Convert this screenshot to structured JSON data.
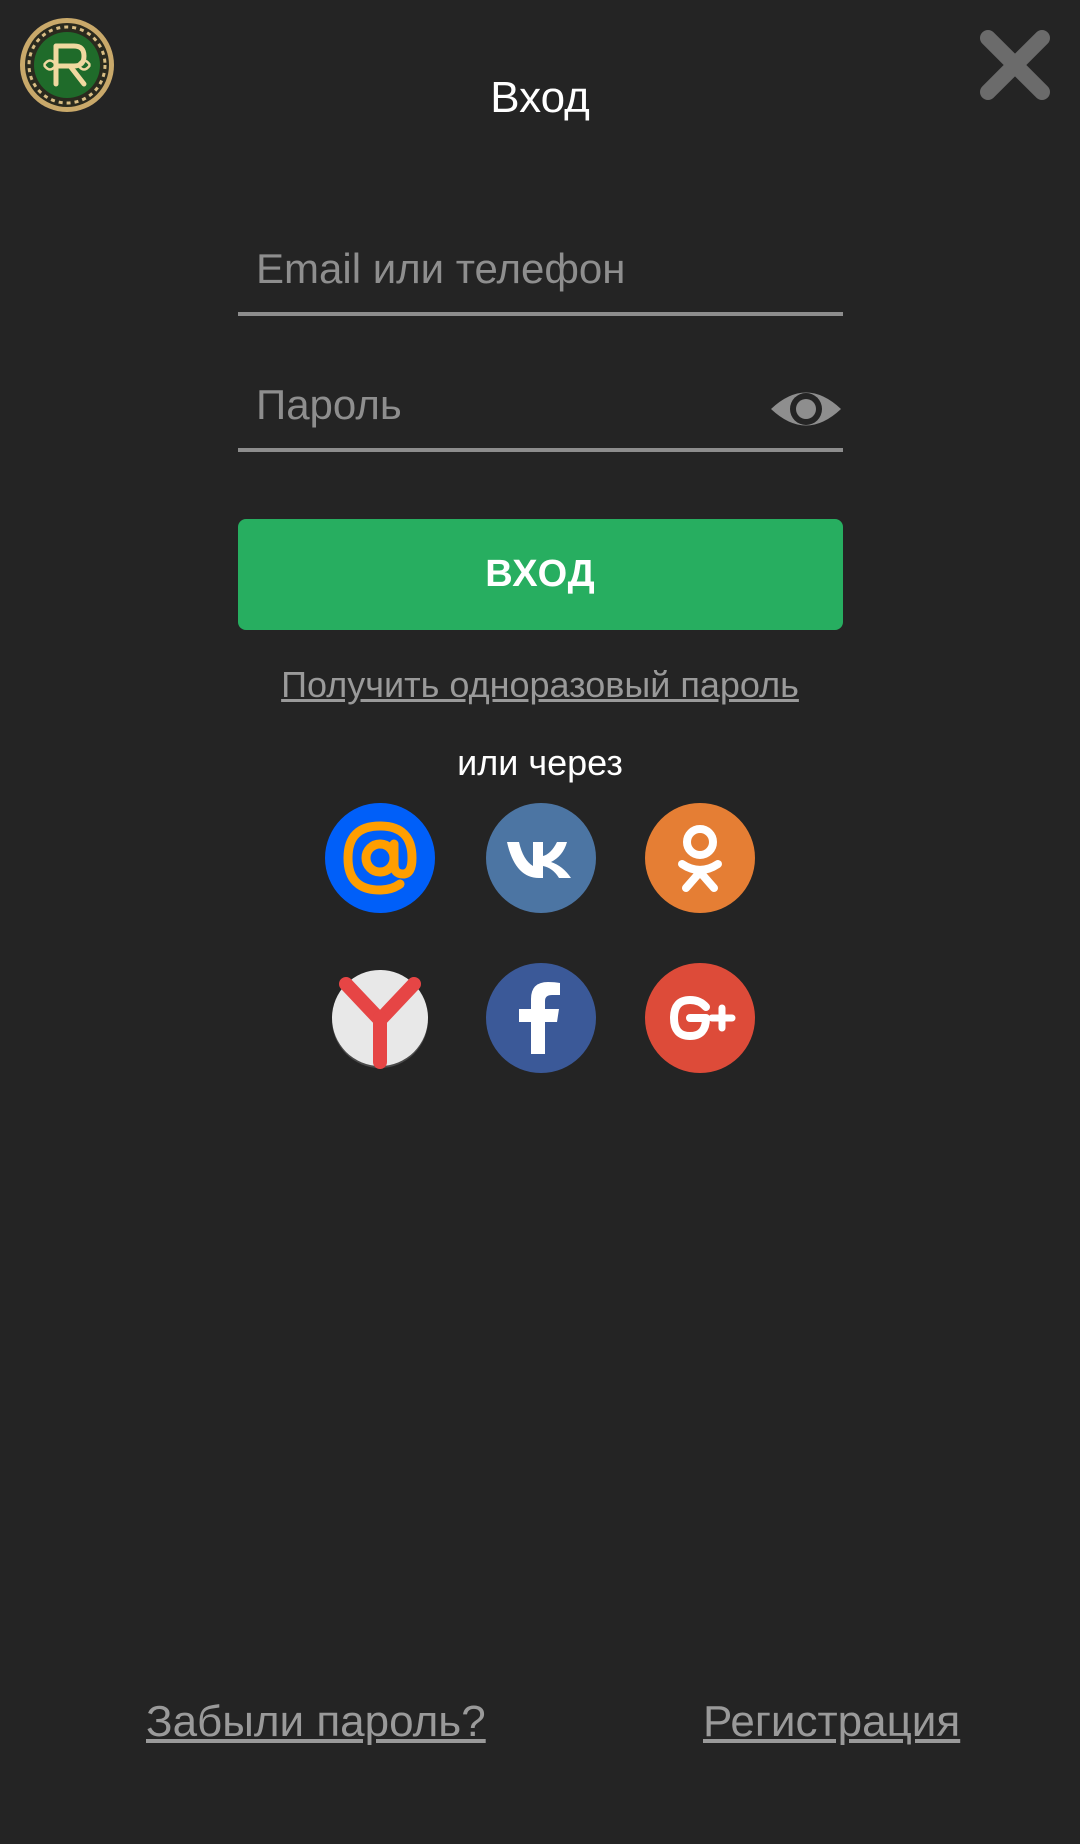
{
  "header": {
    "title": "Вход",
    "logo_icon": "club-logo-icon",
    "close_icon": "close-icon"
  },
  "form": {
    "email": {
      "value": "",
      "placeholder": "Email или телефон"
    },
    "password": {
      "value": "",
      "placeholder": "Пароль",
      "toggle_icon": "eye-icon"
    },
    "submit_label": "ВХОД",
    "otp_link": "Получить одноразовый пароль"
  },
  "social": {
    "label": "или через",
    "providers": [
      {
        "id": "mail-ru",
        "icon": "mail-ru-icon",
        "color": "#005ff9"
      },
      {
        "id": "vk",
        "icon": "vk-icon",
        "color": "#4c75a3"
      },
      {
        "id": "odnoklassniki",
        "icon": "odnoklassniki-icon",
        "color": "#ee8208"
      },
      {
        "id": "yandex",
        "icon": "yandex-icon",
        "color": "#e8e8e8"
      },
      {
        "id": "facebook",
        "icon": "facebook-icon",
        "color": "#3b5998"
      },
      {
        "id": "google-plus",
        "icon": "google-plus-icon",
        "color": "#dd4b39"
      }
    ]
  },
  "footer": {
    "forgot_link": "Забыли пароль?",
    "register_link": "Регистрация"
  },
  "colors": {
    "background": "#242424",
    "accent": "#27ae60",
    "muted_text": "#9a9a9a",
    "underline": "#8d8d8d"
  }
}
